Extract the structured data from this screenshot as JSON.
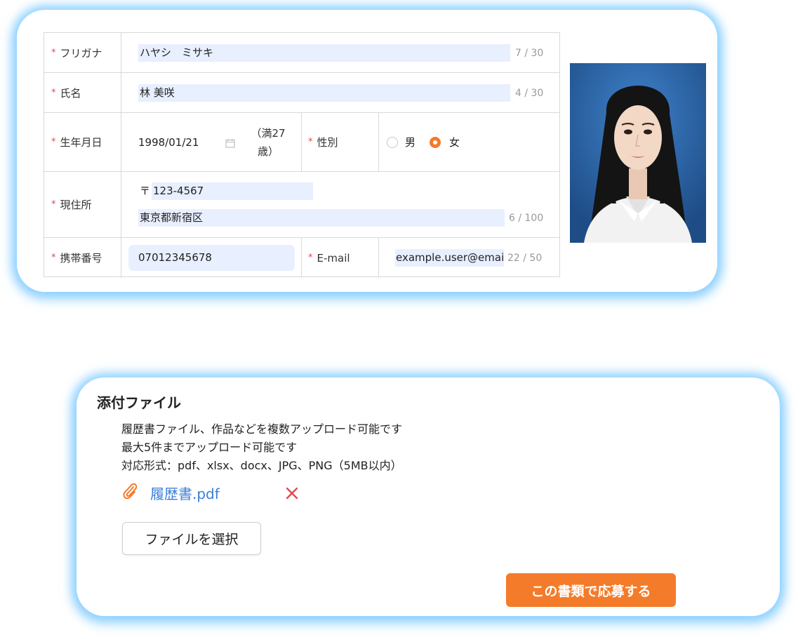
{
  "form": {
    "furigana": {
      "label": "フリガナ",
      "value": "ハヤシ　ミサキ",
      "counter": "7 / 30"
    },
    "name": {
      "label": "氏名",
      "value": "林 美咲",
      "counter": "4 / 30"
    },
    "birthdate": {
      "label": "生年月日",
      "value": "1998/01/21",
      "age_line1": "（満27",
      "age_line2": "歳）"
    },
    "gender": {
      "label": "性別",
      "option_male": "男",
      "option_female": "女",
      "selected": "女"
    },
    "address": {
      "label": "現住所",
      "postal_prefix": "〒",
      "postal_code": "123-4567",
      "value": "東京都新宿区",
      "counter": "6 / 100"
    },
    "phone": {
      "label": "携帯番号",
      "value": "07012345678"
    },
    "email": {
      "label": "E-mail",
      "value": "example.user@emai",
      "counter": "22 / 50"
    },
    "required_mark": "*"
  },
  "attachments": {
    "title": "添付ファイル",
    "desc1": "履歴書ファイル、作品などを複数アップロード可能です",
    "desc2": "最大5件までアップロード可能です",
    "desc3": "対応形式：pdf、xlsx、docx、JPG、PNG（5MB以内）",
    "files": [
      {
        "name": "履歴書.pdf"
      }
    ],
    "select_button": "ファイルを選択",
    "apply_button": "この書類で応募する"
  },
  "colors": {
    "accent": "#f47b2a",
    "link": "#3d7fd6",
    "required": "#e5484d",
    "input_bg": "#e8efff"
  }
}
